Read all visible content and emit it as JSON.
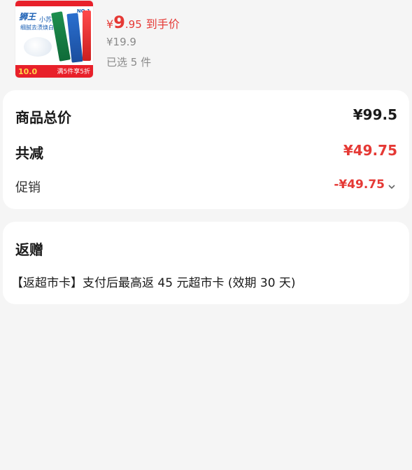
{
  "product": {
    "thumb": {
      "brand_text": "狮王",
      "line1": "小苏打",
      "line2": "细腻去渍焕白",
      "badge": "NO.1",
      "price_tag": "10.0",
      "promo_tag": "满5件享5折"
    },
    "price_yen": "¥",
    "price_int": "9",
    "price_dec": ".95",
    "price_label": "到手价",
    "original_price": "¥19.9",
    "selected_count": "已选 5 件"
  },
  "summary": {
    "total_label": "商品总价",
    "total_value": "¥99.5",
    "reduce_label": "共减",
    "reduce_value": "¥49.75",
    "promo_label": "促销",
    "promo_value": "-¥49.75"
  },
  "gift": {
    "title": "返赠",
    "text": "【返超市卡】支付后最高返 45 元超市卡 (效期 30 天)"
  },
  "colors": {
    "accent_red": "#e53935",
    "background": "#f5f5f5",
    "card": "#ffffff"
  }
}
